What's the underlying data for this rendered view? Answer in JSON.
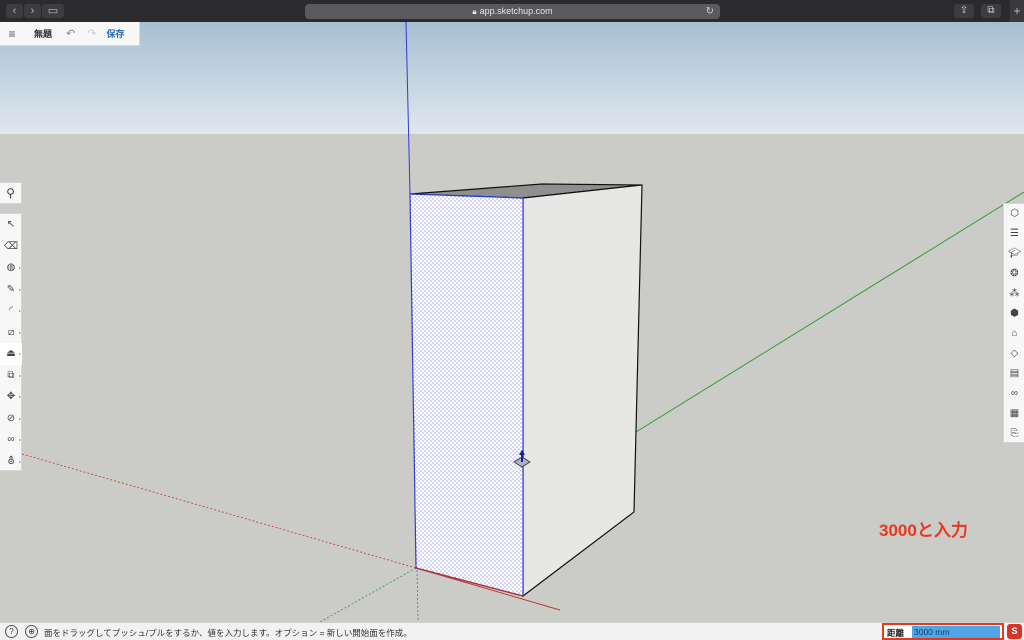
{
  "browser": {
    "url": "app.sketchup.com",
    "back_icon": "chevron-left-icon",
    "forward_icon": "chevron-right-icon",
    "sidebar_icon": "sidebar-icon",
    "share_icon": "share-icon",
    "tabs_icon": "tabs-icon",
    "new_tab": "+"
  },
  "toolbar": {
    "menu_icon": "menu-icon",
    "title": "無題",
    "undo_icon": "undo-icon",
    "redo_icon": "redo-icon",
    "save_label": "保存"
  },
  "left_tools": [
    {
      "name": "select-tool",
      "icon": "arrow-icon"
    },
    {
      "name": "eraser-tool",
      "icon": "eraser-icon"
    },
    {
      "name": "paint-tool",
      "icon": "paint-bucket-icon"
    },
    {
      "name": "pencil-tool",
      "icon": "pencil-icon"
    },
    {
      "name": "arc-tool",
      "icon": "arc-icon"
    },
    {
      "name": "rectangle-tool",
      "icon": "rectangle-icon"
    },
    {
      "name": "push-pull-tool",
      "icon": "push-pull-icon",
      "active": true
    },
    {
      "name": "offset-tool",
      "icon": "offset-icon"
    },
    {
      "name": "move-tool",
      "icon": "move-icon"
    },
    {
      "name": "tape-measure-tool",
      "icon": "tape-icon"
    },
    {
      "name": "walk-tool",
      "icon": "footprints-icon"
    },
    {
      "name": "section-tool",
      "icon": "section-icon"
    }
  ],
  "right_tools": [
    "entity-info-icon",
    "instructor-icon",
    "outliner-icon",
    "components-icon",
    "materials-icon",
    "styles-icon",
    "tags-icon",
    "scenes-icon",
    "display-icon",
    "views-icon",
    "layers-icon",
    "export-icon"
  ],
  "annotation": "3000と入力",
  "status": {
    "message": "面をドラッグしてプッシュ/プルをするか、値を入力します。オプション = 新しい開始面を作成。",
    "measure_label": "距離",
    "measure_value": "3000 mm"
  },
  "colors": {
    "annotation": "#e8381f",
    "axis_red": "#c0392b",
    "axis_green": "#2e9e3b",
    "axis_blue": "#2f3bd8",
    "selection": "#3a3ad8"
  }
}
